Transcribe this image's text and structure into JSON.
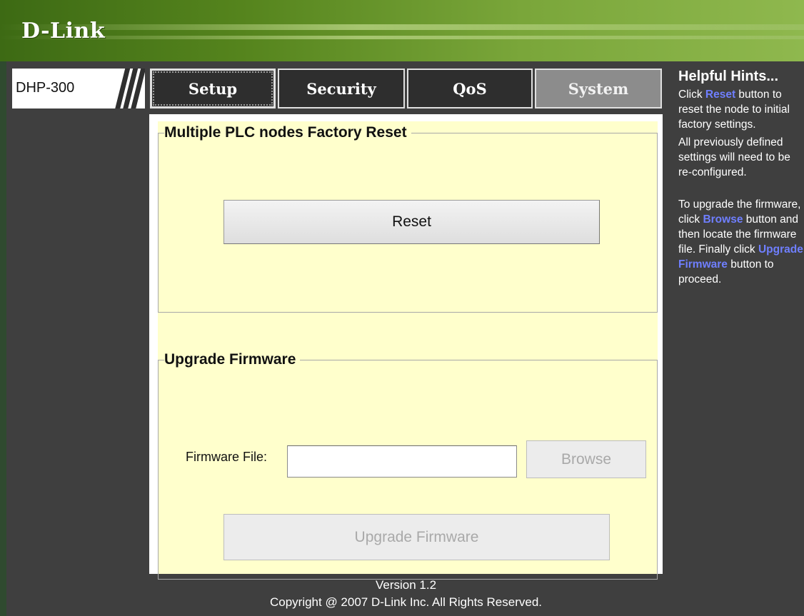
{
  "brand": {
    "logo": "D-Link"
  },
  "model": {
    "label": "DHP-300"
  },
  "tabs": [
    {
      "label": "Setup",
      "state": "active"
    },
    {
      "label": "Security",
      "state": "normal"
    },
    {
      "label": "QoS",
      "state": "normal"
    },
    {
      "label": "System",
      "state": "selected"
    }
  ],
  "factory_reset": {
    "legend": "Multiple PLC nodes Factory Reset",
    "reset_button": "Reset"
  },
  "upgrade": {
    "legend": "Upgrade Firmware",
    "file_label": "Firmware File:",
    "file_value": "",
    "browse_button": "Browse",
    "upgrade_button": "Upgrade Firmware"
  },
  "footer": {
    "version": "Version 1.2",
    "copyright": "Copyright @ 2007 D-Link Inc. All Rights Reserved."
  },
  "hints": {
    "title": "Helpful Hints...",
    "p1_pre": "Click ",
    "p1_kw": "Reset",
    "p1_post": " button to reset the node to initial factory settings.",
    "p2": "All previously defined settings will need to be re-configured.",
    "p3_pre": "To upgrade the firmware, click ",
    "p3_kw": "Browse",
    "p3_mid": " button and then locate the firmware file. Finally click ",
    "p3_kw2": "Upgrade Firmware",
    "p3_post": " button to proceed."
  },
  "colors": {
    "header_green": "#55841d",
    "background_dark": "#3f3f3f",
    "content_panel": "#ffffcc",
    "hint_keyword": "#6f7fff",
    "tab_system_gray": "#8c8c8c"
  }
}
